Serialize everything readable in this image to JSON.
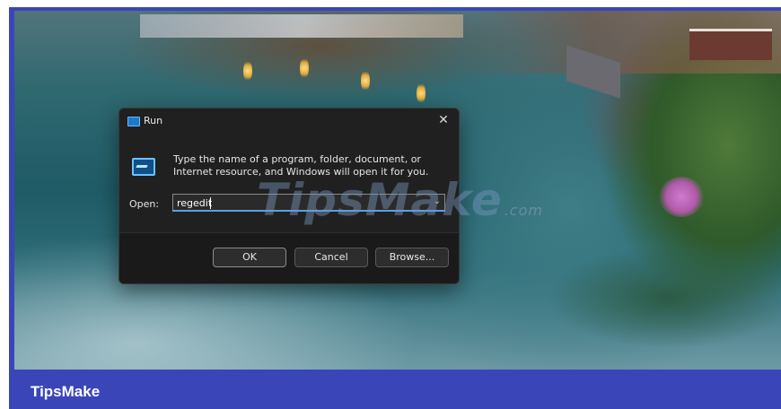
{
  "dialog": {
    "title": "Run",
    "close_glyph": "✕",
    "description": "Type the name of a program, folder, document, or Internet resource, and Windows will open it for you.",
    "open_label": "Open:",
    "open_value": "regedit",
    "dropdown_glyph": "⌄",
    "buttons": {
      "ok": "OK",
      "cancel": "Cancel",
      "browse": "Browse..."
    },
    "icons": [
      "run-app-icon",
      "run-program-icon",
      "close-icon",
      "chevron-down-icon"
    ]
  },
  "watermark": {
    "text": "TipsMake",
    "suffix": ".com"
  },
  "brand": {
    "text": "TipsMake"
  },
  "colors": {
    "frame": "#3a46b8",
    "dialog_bg": "#202020",
    "input_accent": "#5aa0e6"
  }
}
